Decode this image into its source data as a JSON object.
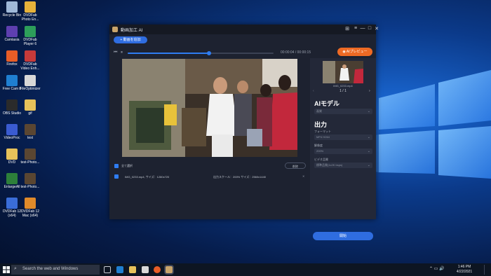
{
  "desktop": {
    "icons": [
      {
        "label": "Recycle Bin",
        "color": "#9fb8d8"
      },
      {
        "label": "DVDFab Photo En...",
        "color": "#e7b23a"
      },
      {
        "label": "Camtasia",
        "color": "#5e3fb0"
      },
      {
        "label": "DVDFab Player 6",
        "color": "#2d9e5a"
      },
      {
        "label": "Firefox",
        "color": "#e85d27"
      },
      {
        "label": "DVDFab Video Enh...",
        "color": "#c63a3a"
      },
      {
        "label": "Free Cam 8",
        "color": "#1f7fd1"
      },
      {
        "label": "FileOptimizer",
        "color": "#d8d8d8"
      },
      {
        "label": "OBS Studio",
        "color": "#2b2b2b"
      },
      {
        "label": "gif",
        "color": "#e7c25a"
      },
      {
        "label": "VideoProc",
        "color": "#3a5bd0"
      },
      {
        "label": "test",
        "color": "#5a4632"
      },
      {
        "label": "DVD",
        "color": "#e7c25a"
      },
      {
        "label": "test-Photo...",
        "color": "#5a4632"
      },
      {
        "label": "EnlargeAll",
        "color": "#2d7f3a"
      },
      {
        "label": "test-Photo...",
        "color": "#5a4632"
      },
      {
        "label": "DVDFab 12 (x64)",
        "color": "#3a6dd8"
      },
      {
        "label": "DVDFab 12 Mac (x64)",
        "color": "#e08a2a"
      }
    ]
  },
  "app": {
    "title": "動画加工 AI",
    "add_button": "動画を追加",
    "time_display": "00:00:04 / 00:00:15",
    "progress": 0.56,
    "ai_preview_button": "AIプレビュー",
    "select_all": "全て選択",
    "delete_button": "削除",
    "file": {
      "name": "IMG_0233.mp4, サイズ：1280x720",
      "output": "出力スケール：200% サイズ：2560x1440",
      "close": "✕"
    },
    "side": {
      "thumb_name": "IMG_0233.mp4",
      "pager": "1 / 1",
      "ai_model_heading": "AIモデル",
      "ai_model_value": "画質",
      "output_heading": "出力",
      "format_label": "フォーマット",
      "format_value": "MP4 H264",
      "resolution_label": "解像度",
      "resolution_value": "200%",
      "bitrate_label": "ビデオ品質",
      "bitrate_value": "標準品質(1x2K bsps)",
      "start_button": "開始"
    },
    "window_controls": [
      "⊞",
      "≡",
      "—",
      "□",
      "✕"
    ]
  },
  "taskbar": {
    "search_placeholder": "Search the web and Windows",
    "time": "1:46 PM",
    "date": "4/22/2021"
  },
  "colors": {
    "accent_blue": "#2f6de0",
    "accent_orange": "#ee6a24"
  }
}
